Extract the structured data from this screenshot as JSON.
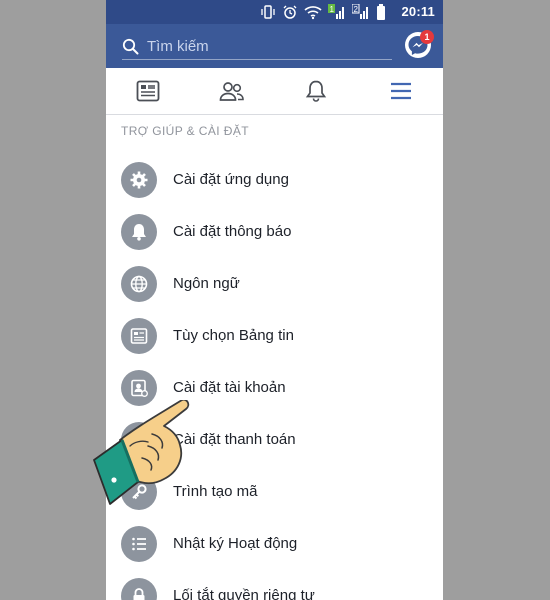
{
  "status_bar": {
    "time": "20:11"
  },
  "search": {
    "placeholder": "Tìm kiếm"
  },
  "messenger": {
    "badge_count": "1"
  },
  "nav": {
    "icons": [
      "news-feed-icon",
      "friends-icon",
      "notifications-icon",
      "menu-icon"
    ],
    "active_color": "#4267b2"
  },
  "section": {
    "title": "TRỢ GIÚP & CÀI ĐẶT"
  },
  "menu": {
    "items": [
      {
        "label": "Cài đặt ứng dụng",
        "icon": "gear-icon"
      },
      {
        "label": "Cài đặt thông báo",
        "icon": "bell-icon"
      },
      {
        "label": "Ngôn ngữ",
        "icon": "globe-icon"
      },
      {
        "label": "Tùy chọn Bảng tin",
        "icon": "news-feed-icon"
      },
      {
        "label": "Cài đặt tài khoản",
        "icon": "account-settings-icon"
      },
      {
        "label": "Cài đặt thanh toán",
        "icon": "payment-icon"
      },
      {
        "label": "Trình tạo mã",
        "icon": "key-icon"
      },
      {
        "label": "Nhật ký Hoạt động",
        "icon": "list-icon"
      },
      {
        "label": "Lối tắt quyền riêng tư",
        "icon": "lock-icon"
      }
    ]
  },
  "colors": {
    "header": "#3b5998",
    "status_bar": "#2f4a88",
    "icon_circle": "#8d949e",
    "text": "#1d2129"
  }
}
